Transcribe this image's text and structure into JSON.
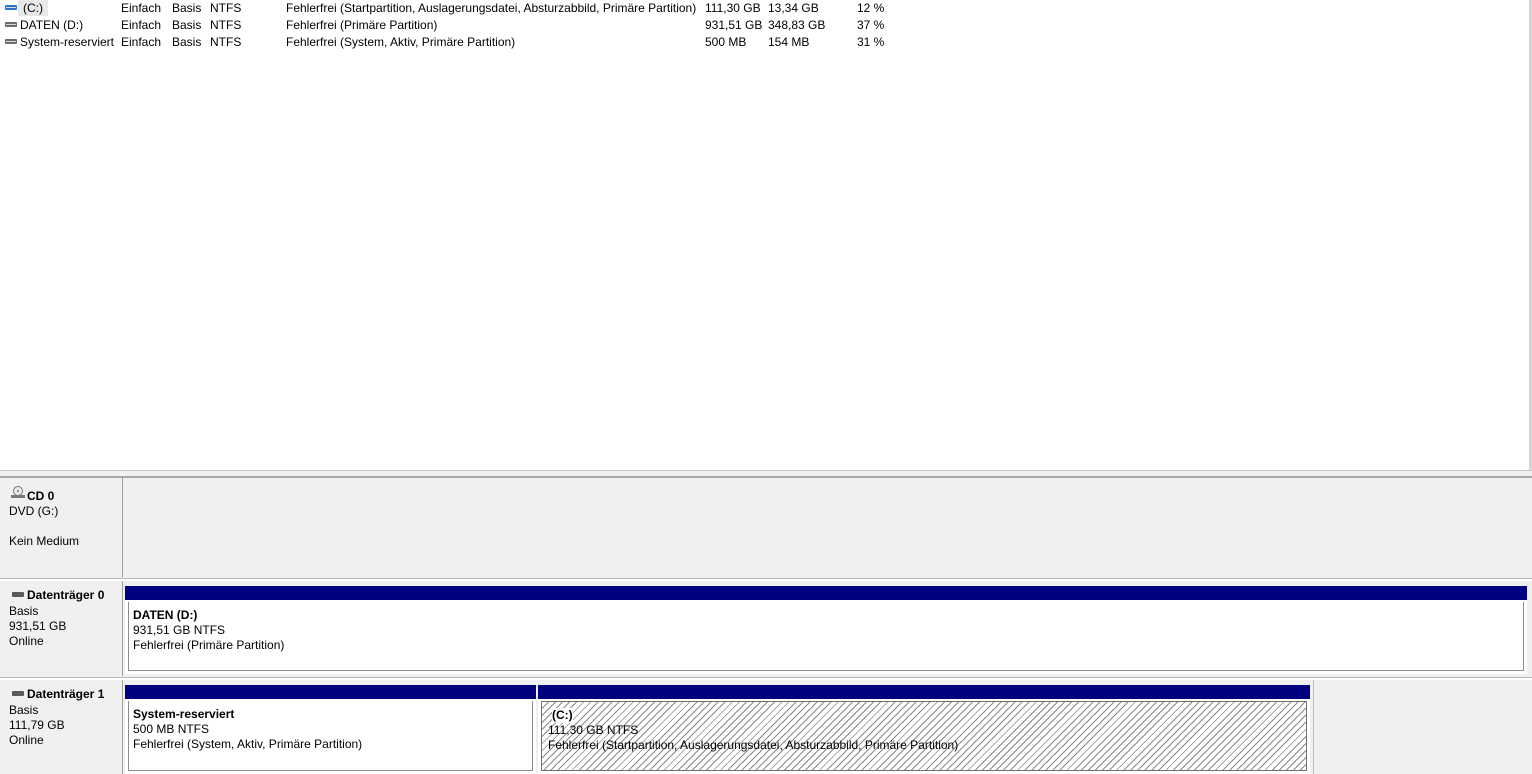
{
  "volumes": [
    {
      "name": "(C:)",
      "icon": "system-drive-icon",
      "layout": "Einfach",
      "type": "Basis",
      "fs": "NTFS",
      "status": "Fehlerfrei (Startpartition, Auslagerungsdatei, Absturzabbild, Primäre Partition)",
      "capacity": "111,30 GB",
      "free": "13,34 GB",
      "pct_free": "12 %"
    },
    {
      "name": "DATEN (D:)",
      "icon": "drive-icon",
      "layout": "Einfach",
      "type": "Basis",
      "fs": "NTFS",
      "status": "Fehlerfrei (Primäre Partition)",
      "capacity": "931,51 GB",
      "free": "348,83 GB",
      "pct_free": "37 %"
    },
    {
      "name": "System-reserviert",
      "icon": "drive-icon",
      "layout": "Einfach",
      "type": "Basis",
      "fs": "NTFS",
      "status": "Fehlerfrei (System, Aktiv, Primäre Partition)",
      "capacity": "500 MB",
      "free": "154 MB",
      "pct_free": "31 %"
    }
  ],
  "cd": {
    "title": "CD 0",
    "type": "DVD (G:)",
    "status": "Kein Medium"
  },
  "disk0": {
    "title": "Datenträger 0",
    "type": "Basis",
    "size": "931,51 GB",
    "status": "Online",
    "partitions": [
      {
        "name": "DATEN  (D:)",
        "size": "931,51 GB NTFS",
        "status": "Fehlerfrei (Primäre Partition)"
      }
    ]
  },
  "disk1": {
    "title": "Datenträger 1",
    "type": "Basis",
    "size": "111,79 GB",
    "status": "Online",
    "partitions": [
      {
        "name": "System-reserviert",
        "size": "500 MB NTFS",
        "status": "Fehlerfrei (System, Aktiv, Primäre Partition)"
      },
      {
        "name": "(C:)",
        "size": "111,30 GB NTFS",
        "status": "Fehlerfrei (Startpartition, Auslagerungsdatei, Absturzabbild, Primäre Partition)"
      }
    ]
  },
  "colors": {
    "partition_bar": "#000080",
    "background": "#f0f0f0",
    "system_drive_icon": "#2f74c7"
  }
}
